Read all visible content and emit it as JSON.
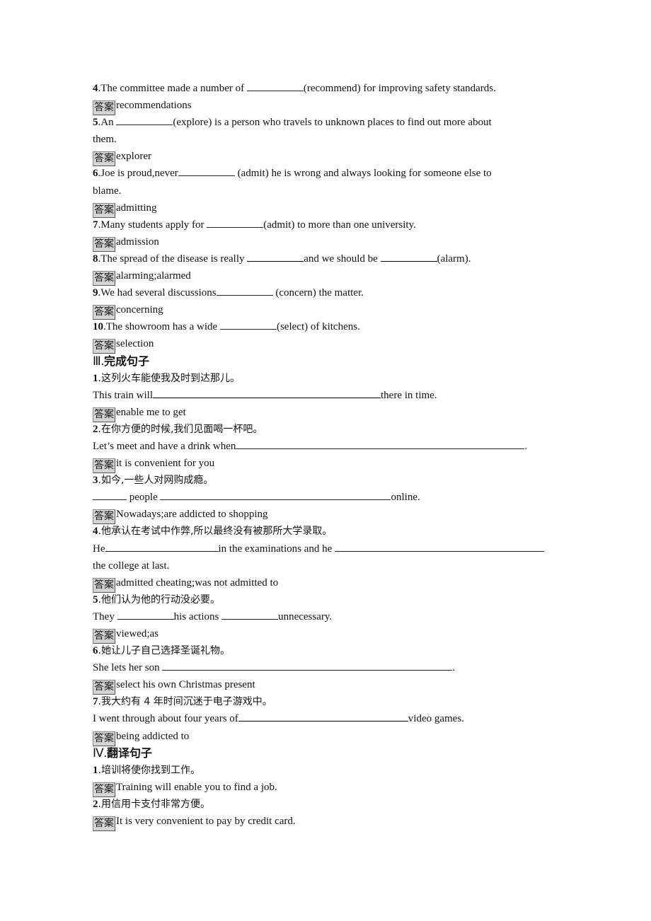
{
  "answer_label": "答案",
  "part2_items": [
    {
      "num": "4",
      "before": ".The committee made a number of ",
      "after": "(recommend) for improving safety standards.",
      "answer": "recommendations"
    },
    {
      "num": "5",
      "before": ".An ",
      "after": "(explore) is a person who travels to unknown places to find out more about",
      "continuation": "them.",
      "answer": "explorer"
    },
    {
      "num": "6",
      "before": ".Joe is proud,never",
      "after": " (admit) he is wrong and always looking for someone else to",
      "continuation": "blame.",
      "answer": "admitting"
    },
    {
      "num": "7",
      "before": ".Many students apply for ",
      "after": "(admit) to more than one university.",
      "answer": "admission"
    },
    {
      "num": "8",
      "before": ".The spread of the disease is really ",
      "middle": "and we should be ",
      "after": "(alarm).",
      "answer": "alarming;alarmed"
    },
    {
      "num": "9",
      "before": ".We had several discussions",
      "after": " (concern) the matter.",
      "answer": "concerning"
    },
    {
      "num": "10",
      "before": ".The showroom has a wide ",
      "after": "(select) of kitchens.",
      "answer": "selection"
    }
  ],
  "section3": {
    "roman": "Ⅲ.",
    "title": "完成句子",
    "items": [
      {
        "num": "1",
        "chinese": ".这列火车能使我及时到达那儿。",
        "before": "This train will",
        "after": "there in time.",
        "answer": "enable me to get"
      },
      {
        "num": "2",
        "chinese": ".在你方便的时候,我们见面喝一杯吧。",
        "before": "Let’s meet and have a drink when",
        "after": ".",
        "answer": "it is convenient for you"
      },
      {
        "num": "3",
        "chinese": ".如今,一些人对网购成瘾。",
        "middle": " people ",
        "after": "online.",
        "answer": "Nowadays;are addicted to shopping"
      },
      {
        "num": "4",
        "chinese": ".他承认在考试中作弊,所以最终没有被那所大学录取。",
        "before": "He",
        "middle": "in the examinations and he ",
        "continuation": "the college at last.",
        "answer": "admitted cheating;was not admitted to"
      },
      {
        "num": "5",
        "chinese": ".他们认为他的行动没必要。",
        "before": "They ",
        "middle": "his actions ",
        "after": "unnecessary.",
        "answer": "viewed;as"
      },
      {
        "num": "6",
        "chinese": ".她让儿子自己选择圣诞礼物。",
        "before": "She lets her son ",
        "after": ".",
        "answer": "select his own Christmas present"
      },
      {
        "num": "7",
        "chinese": ".我大约有 4 年时间沉迷于电子游戏中。",
        "before": "I went through about four years of",
        "after": "video games.",
        "answer": "being addicted to"
      }
    ]
  },
  "section4": {
    "roman": "Ⅳ.",
    "title": "翻译句子",
    "items": [
      {
        "num": "1",
        "chinese": ".培训将使你找到工作。",
        "answer": "Training will enable you to find a job."
      },
      {
        "num": "2",
        "chinese": ".用信用卡支付非常方便。",
        "answer": "It is very convenient to pay by credit card."
      }
    ]
  }
}
